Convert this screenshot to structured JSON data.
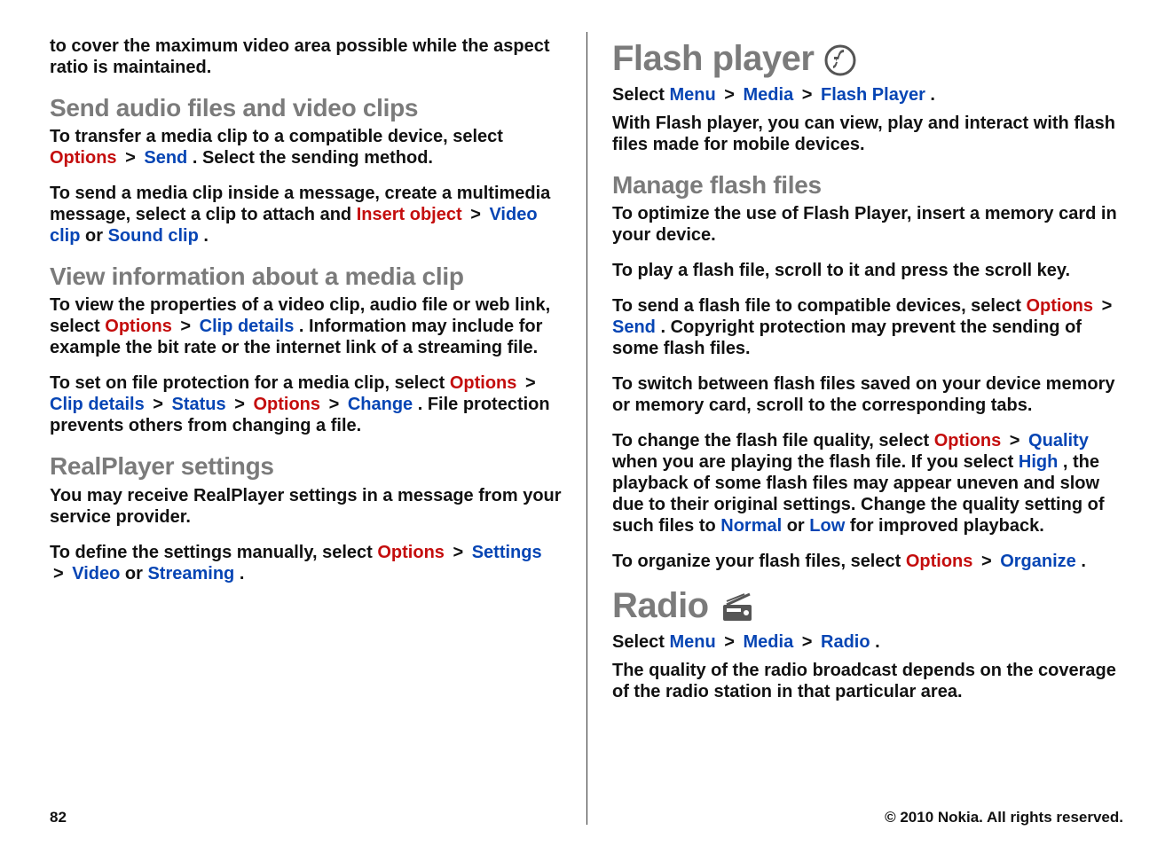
{
  "left": {
    "intro": "to cover the maximum video area possible while the aspect ratio is maintained.",
    "sendHeading": "Send audio files and video clips",
    "sendP1a": "To transfer a media clip to a compatible device, select ",
    "sendP1_opt": "Options",
    "sendP1_arrow": ">",
    "sendP1_send": "Send",
    "sendP1b": ". Select the sending method.",
    "sendP2a": "To send a media clip inside a message, create a multimedia message, select a clip to attach and ",
    "sendP2_insert": "Insert object",
    "sendP2_video": "Video clip",
    "sendP2_or": " or ",
    "sendP2_sound": "Sound clip",
    "sendP2_dot": ".",
    "viewHeading": "View information about a media clip",
    "viewP1a": "To view the properties of a video clip, audio file or web link, select ",
    "view_opt": "Options",
    "view_clip": "Clip details",
    "viewP1b": ". Information may include for example the bit rate or the internet link of a streaming file.",
    "viewP2a": "To set on file protection for a media clip, select ",
    "view2_opt": "Options",
    "view2_clip": "Clip details",
    "view2_status": "Status",
    "view2_opt2": "Options",
    "view2_change": "Change",
    "viewP2b": ". File protection prevents others from changing a file.",
    "realHeading": "RealPlayer settings",
    "realP1": "You may receive RealPlayer settings in a message from your service provider.",
    "realP2a": "To define the settings manually, select ",
    "real_opt": "Options",
    "real_settings": "Settings",
    "real_video": "Video",
    "real_or": " or ",
    "real_stream": "Streaming",
    "realP2b": "."
  },
  "right": {
    "flashTitle": "Flash player",
    "flashSelA": "Select ",
    "flash_menu": "Menu",
    "flash_media": "Media",
    "flash_fp": "Flash Player",
    "flashSelB": ".",
    "flashIntro": "With Flash player, you can view, play and interact with flash files made for mobile devices.",
    "manageHeading": "Manage flash files",
    "manageP1": "To optimize the use of Flash Player, insert a memory card in your device.",
    "manageP2": "To play a flash file, scroll to it and press the scroll key.",
    "manageP3a": "To send a flash file to compatible devices, select ",
    "m3_opt": "Options",
    "m3_send": "Send",
    "manageP3b": ". Copyright protection may prevent the sending of some flash files.",
    "manageP4": "To switch between flash files saved on your device memory or memory card, scroll to the corresponding tabs.",
    "manageP5a": "To change the flash file quality, select ",
    "m5_opt": "Options",
    "m5_quality": "Quality",
    "manageP5b": " when you are playing the flash file. If you select ",
    "m5_high": "High",
    "manageP5c": ", the playback of some flash files may appear uneven and slow due to their original settings. Change the quality setting of such files to ",
    "m5_normal": "Normal",
    "m5_or": " or ",
    "m5_low": "Low",
    "manageP5d": " for improved playback.",
    "manageP6a": "To organize your flash files, select ",
    "m6_opt": "Options",
    "m6_org": "Organize",
    "manageP6b": ".",
    "radioTitle": "Radio",
    "radioSelA": "Select ",
    "radio_menu": "Menu",
    "radio_media": "Media",
    "radio_radio": "Radio",
    "radioSelB": ".",
    "radioP": "The quality of the radio broadcast depends on the coverage of the radio station in that particular area."
  },
  "footer": {
    "page": "82",
    "copyright": "© 2010 Nokia. All rights reserved."
  },
  "glyphs": {
    "arrow": ">"
  }
}
